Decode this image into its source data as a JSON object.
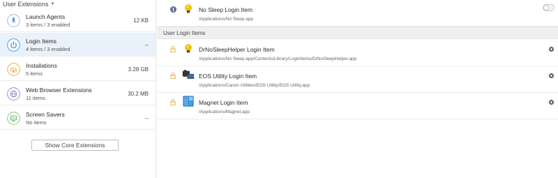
{
  "sidebar": {
    "header": "User Extensions",
    "categories": [
      {
        "title": "Launch Agents",
        "subtitle": "3 items / 3 enabled",
        "size": "12 KB",
        "icon": "rocket-icon"
      },
      {
        "title": "Login Items",
        "subtitle": "4 items / 3 enabled",
        "size": "--",
        "icon": "power-icon",
        "selected": true
      },
      {
        "title": "Installations",
        "subtitle": "5 items",
        "size": "3.28 GB",
        "icon": "download-cloud-icon"
      },
      {
        "title": "Web Browser Extensions",
        "subtitle": "11 items",
        "size": "30.2 MB",
        "icon": "globe-icon"
      },
      {
        "title": "Screen Savers",
        "subtitle": "No items",
        "size": "--",
        "icon": "monitor-icon"
      }
    ],
    "show_core_label": "Show Core Extensions"
  },
  "main": {
    "top_item": {
      "name": "No Sleep Login Item",
      "path": "/Applications/No Sleep.app",
      "enabled": false,
      "icon": "lightbulb-icon"
    },
    "section_header": "User Login Items",
    "items": [
      {
        "name": "DrNoSleepHelper Login Item",
        "path": "/Applications/No Sleep.app/Contents/Library/LoginItems/DrNoSleepHelper.app",
        "icon": "lightbulb-icon"
      },
      {
        "name": "EOS Utility Login Item",
        "path": "/Applications/Canon Utilities/EOS Utility/EOS Utility.app",
        "icon": "camera-laptop-icon"
      },
      {
        "name": "Magnet Login Item",
        "path": "/Applications/Magnet.app",
        "icon": "magnet-windows-icon"
      }
    ]
  },
  "colors": {
    "selected_bg": "#e9f1fb",
    "accent_blue": "#3f8fd6",
    "lock_orange": "#e8a23a",
    "lightbulb_yellow": "#f5c400"
  }
}
